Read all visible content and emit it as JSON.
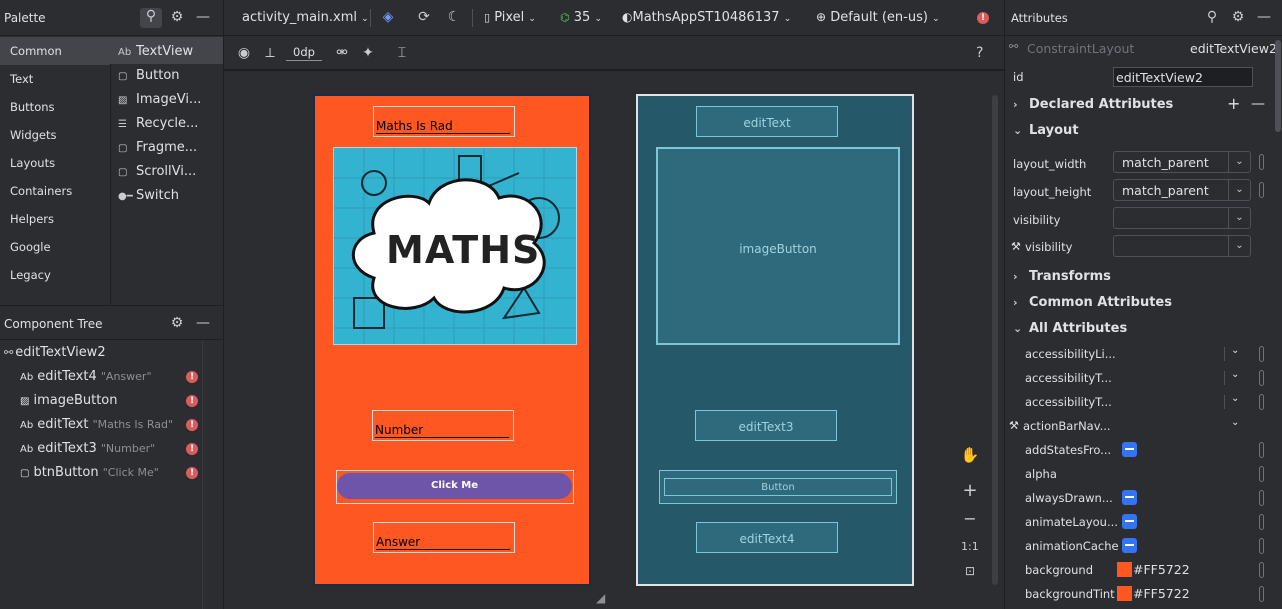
{
  "palette": {
    "title": "Palette",
    "categories": [
      "Common",
      "Text",
      "Buttons",
      "Widgets",
      "Layouts",
      "Containers",
      "Helpers",
      "Google",
      "Legacy"
    ],
    "items": [
      {
        "icon": "Ab",
        "label": "TextView"
      },
      {
        "icon": "▢",
        "label": "Button"
      },
      {
        "icon": "▨",
        "label": "ImageVi..."
      },
      {
        "icon": "☰",
        "label": "Recycle..."
      },
      {
        "icon": "▢",
        "label": "Fragme..."
      },
      {
        "icon": "▢",
        "label": "ScrollVi..."
      },
      {
        "icon": "●━",
        "label": "Switch"
      }
    ]
  },
  "tree": {
    "title": "Component Tree",
    "root": "editTextView2",
    "rows": [
      {
        "icon": "Ab",
        "name": "editText4",
        "sub": "\"Answer\""
      },
      {
        "icon": "▨",
        "name": "imageButton",
        "sub": ""
      },
      {
        "icon": "Ab",
        "name": "editText",
        "sub": "\"Maths Is Rad\""
      },
      {
        "icon": "Ab",
        "name": "editText3",
        "sub": "\"Number\""
      },
      {
        "icon": "▢",
        "name": "btnButton",
        "sub": "\"Click Me\""
      }
    ]
  },
  "toolbar": {
    "file": "activity_main.xml",
    "device": "Pixel",
    "api": "35",
    "theme": "MathsAppST10486137",
    "locale": "Default (en-us)",
    "margin": "0dp",
    "help": "?"
  },
  "design": {
    "bg": "#FF5722",
    "title_text": "Maths Is Rad",
    "image_word": "MATHS",
    "number_hint": "Number",
    "button_text": "Click Me",
    "answer_hint": "Answer"
  },
  "blueprint": {
    "edit_text": "editText",
    "image_button": "imageButton",
    "edit_text3": "editText3",
    "button": "Button",
    "edit_text4": "editText4"
  },
  "zoom": {
    "one_to_one": "1:1"
  },
  "attrs": {
    "title": "Attributes",
    "layout_type": "ConstraintLayout",
    "component": "editTextView2",
    "id_label": "id",
    "id_value": "editTextView2",
    "sections": {
      "declared": "Declared Attributes",
      "layout": "Layout",
      "transforms": "Transforms",
      "common": "Common Attributes",
      "all": "All Attributes"
    },
    "layout_width_label": "layout_width",
    "layout_width": "match_parent",
    "layout_height_label": "layout_height",
    "layout_height": "match_parent",
    "visibility_label": "visibility",
    "visibility2_label": "visibility",
    "all": [
      "accessibilityLi...",
      "accessibilityT...",
      "accessibilityT...",
      "actionBarNav...",
      "addStatesFro...",
      "alpha",
      "alwaysDrawn...",
      "animateLayou...",
      "animationCache",
      "background",
      "backgroundTint"
    ],
    "background_value": "#FF5722",
    "background_tint_value": "#FF5722"
  }
}
